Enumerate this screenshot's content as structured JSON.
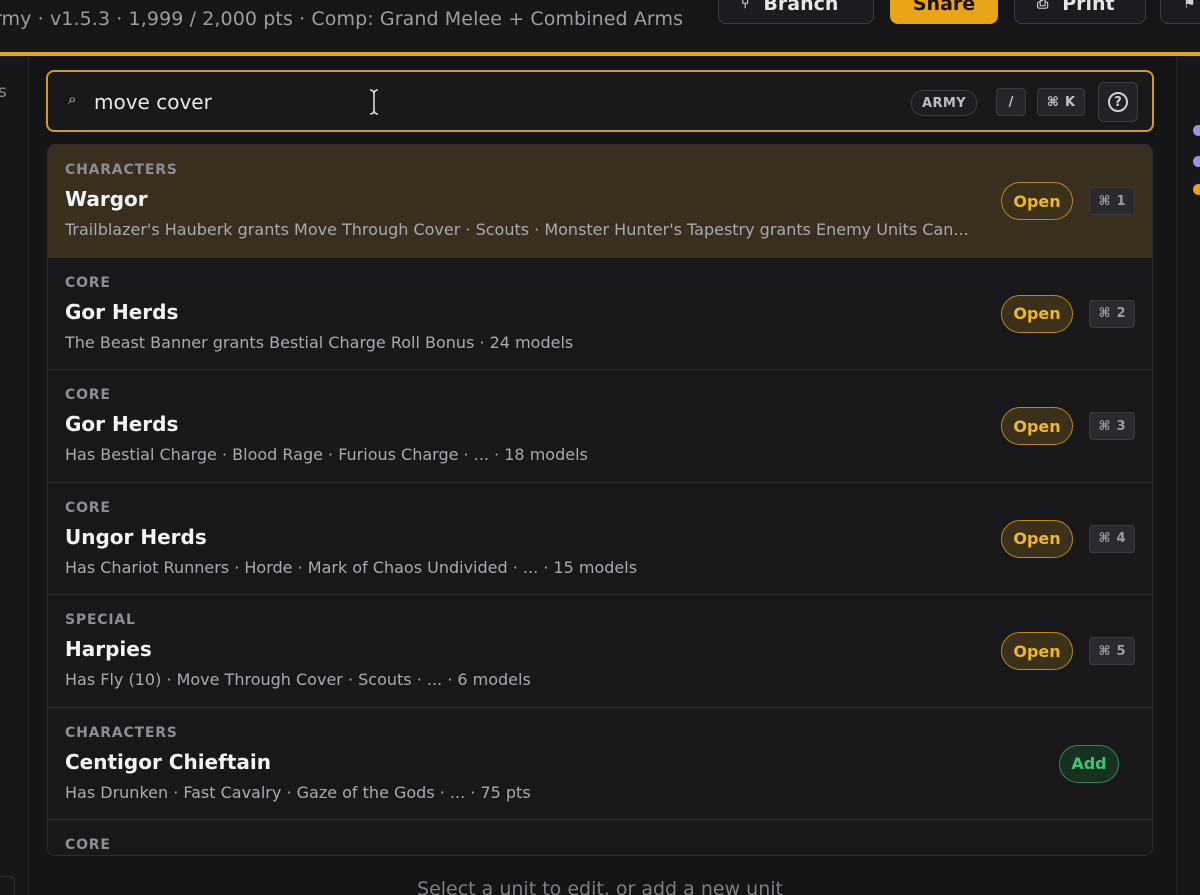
{
  "topbar": {
    "meta": "rmy · v1.5.3 · 1,999 / 2,000 pts · Comp: Grand Melee + Combined Arms",
    "branch_label": "Branch",
    "share_label": "Share",
    "print_label": "Print",
    "accent_color": "#e8a417"
  },
  "left_rail": {
    "letter": "s"
  },
  "right_rail": {
    "dot_colors": [
      "#a78bfa",
      "#a78bfa",
      "#f59e0b"
    ]
  },
  "search": {
    "value": "move cover",
    "scope_pill": "ARMY",
    "shortcut_slash": "/",
    "shortcut_cmd": "⌘",
    "shortcut_key": "K",
    "help_label": "?"
  },
  "results": [
    {
      "category": "CHARACTERS",
      "name": "Wargor",
      "desc": "Trailblazer's Hauberk grants Move Through Cover · Scouts · Monster Hunter's Tapestry grants Enemy Units Can...",
      "action": "Open",
      "shortcut": "1",
      "active": true
    },
    {
      "category": "CORE",
      "name": "Gor Herds",
      "desc": "The Beast Banner grants Bestial Charge Roll Bonus · 24 models",
      "action": "Open",
      "shortcut": "2"
    },
    {
      "category": "CORE",
      "name": "Gor Herds",
      "desc": "Has Bestial Charge · Blood Rage · Furious Charge · ... · 18 models",
      "action": "Open",
      "shortcut": "3"
    },
    {
      "category": "CORE",
      "name": "Ungor Herds",
      "desc": "Has Chariot Runners · Horde · Mark of Chaos Undivided · ... · 15 models",
      "action": "Open",
      "shortcut": "4"
    },
    {
      "category": "SPECIAL",
      "name": "Harpies",
      "desc": "Has Fly (10) · Move Through Cover · Scouts · ... · 6 models",
      "action": "Open",
      "shortcut": "5"
    },
    {
      "category": "CHARACTERS",
      "name": "Centigor Chieftain",
      "desc": "Has Drunken · Fast Cavalry · Gaze of the Gods · ... · 75 pts",
      "action": "Add",
      "shortcut": ""
    },
    {
      "category": "CORE",
      "name": "",
      "desc": "",
      "action": "",
      "shortcut": ""
    }
  ],
  "footer": {
    "hint": "Select a unit to edit, or add a new unit"
  }
}
